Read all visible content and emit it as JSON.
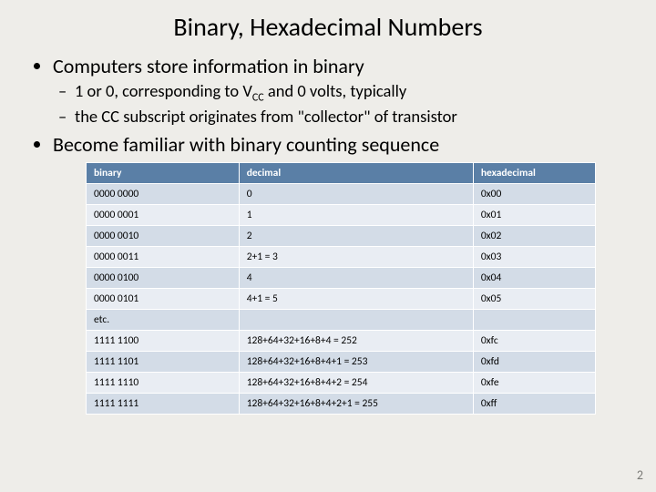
{
  "title": "Binary, Hexadecimal Numbers",
  "bullets": {
    "b1": "Computers store information in binary",
    "b1_sub1_pre": " 1 or 0, corresponding to V",
    "b1_sub1_cc": "CC",
    "b1_sub1_post": " and 0 volts, typically",
    "b1_sub2": " the CC subscript originates from \"collector\" of transistor",
    "b2": "Become familiar with binary counting sequence"
  },
  "table": {
    "headers": {
      "c1": "binary",
      "c2": "decimal",
      "c3": "hexadecimal"
    },
    "rows": [
      {
        "c1": "0000 0000",
        "c2": "0",
        "c3": "0x00"
      },
      {
        "c1": "0000 0001",
        "c2": "1",
        "c3": "0x01"
      },
      {
        "c1": "0000 0010",
        "c2": "2",
        "c3": "0x02"
      },
      {
        "c1": "0000 0011",
        "c2": "2+1 = 3",
        "c3": "0x03"
      },
      {
        "c1": "0000 0100",
        "c2": "4",
        "c3": "0x04"
      },
      {
        "c1": "0000 0101",
        "c2": "4+1 = 5",
        "c3": "0x05"
      },
      {
        "c1": "etc.",
        "c2": "",
        "c3": ""
      },
      {
        "c1": "1111 1100",
        "c2": "128+64+32+16+8+4 = 252",
        "c3": "0xfc"
      },
      {
        "c1": "1111 1101",
        "c2": "128+64+32+16+8+4+1 = 253",
        "c3": "0xfd"
      },
      {
        "c1": "1111 1110",
        "c2": "128+64+32+16+8+4+2 = 254",
        "c3": "0xfe"
      },
      {
        "c1": "1111 1111",
        "c2": "128+64+32+16+8+4+2+1 = 255",
        "c3": "0xff"
      }
    ]
  },
  "page_number": "2"
}
